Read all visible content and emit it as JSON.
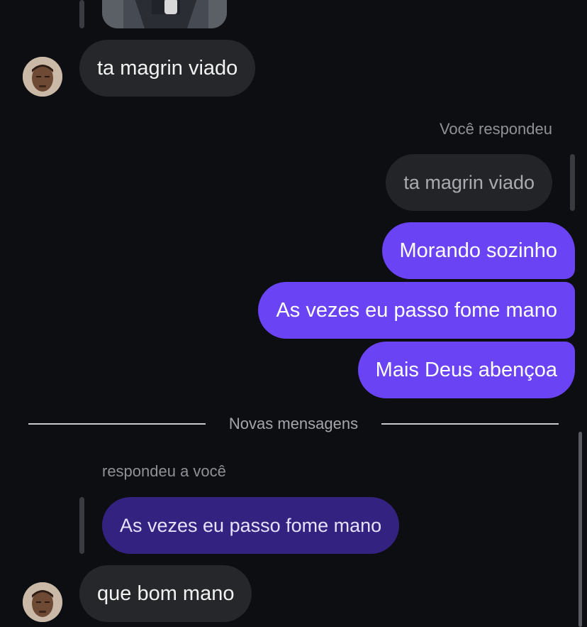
{
  "chat": {
    "msg1": {
      "text": "ta magrin viado"
    },
    "reply_header": "Você respondeu",
    "quoted_own": "ta magrin viado",
    "sent_messages": [
      {
        "text": "Morando sozinho"
      },
      {
        "text": "As vezes eu passo fome mano"
      },
      {
        "text": "Mais Deus abençoa"
      }
    ],
    "divider_label": "Novas mensagens",
    "reply_header_other": "respondeu a você",
    "quoted_other": "As vezes eu passo fome mano",
    "msg_last": {
      "text": "que bom mano"
    }
  },
  "colors": {
    "background": "#0c0e12",
    "sent_bubble": "#6a43f5",
    "received_bubble": "#26272b",
    "quoted_reply_bubble": "#33227f"
  }
}
